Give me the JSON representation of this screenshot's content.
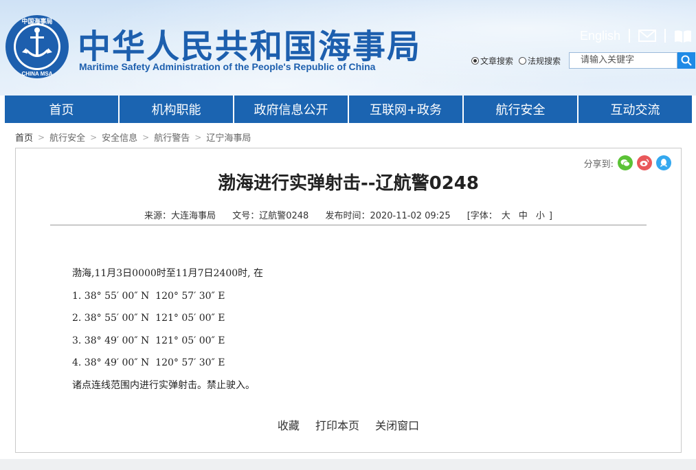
{
  "header": {
    "logo_text_cn": "中国海事局",
    "logo_text_en": "CHINA MSA",
    "title_cn": "中华人民共和国海事局",
    "title_en": "Maritime Safety Administration of the People's Republic of China",
    "english_link": "English",
    "mail_icon": "mail-icon",
    "book_icon": "book-icon"
  },
  "search": {
    "options": [
      {
        "label": "文章搜索",
        "selected": true
      },
      {
        "label": "法规搜索",
        "selected": false
      }
    ],
    "placeholder": "请输入关键字",
    "button_icon": "search-icon"
  },
  "nav": {
    "items": [
      "首页",
      "机构职能",
      "政府信息公开",
      "互联网+政务",
      "航行安全",
      "互动交流"
    ]
  },
  "breadcrumb": [
    "首页",
    "航行安全",
    "安全信息",
    "航行警告",
    "辽宁海事局"
  ],
  "share": {
    "label": "分享到:",
    "icons": [
      "wechat-icon",
      "weibo-icon",
      "qq-icon"
    ]
  },
  "article": {
    "title": "渤海进行实弹射击--辽航警0248",
    "source": "来源：大连海事局",
    "doc_no": "文号：辽航警0248",
    "publish_time": "发布时间：2020-11-02 09:25",
    "font_size_label": "[字体：",
    "font_sizes": [
      "大",
      "中",
      "小"
    ],
    "font_size_close": "]",
    "lines": [
      "渤海,11月3日0000时至11月7日2400时, 在",
      "1. 38° 55′ 00″ N  120° 57′ 30″ E",
      "2. 38° 55′ 00″ N  121° 05′ 00″ E",
      "3. 38° 49′ 00″ N  121° 05′ 00″ E",
      "4. 38° 49′ 00″ N  120° 57′ 30″ E",
      "诸点连线范围内进行实弹射击。禁止驶入。"
    ],
    "actions": [
      "收藏",
      "打印本页",
      "关闭窗口"
    ]
  },
  "colors": {
    "brand_blue": "#1d5fae",
    "nav_blue": "#1b64b1",
    "wechat_green": "#5bc236",
    "weibo_red": "#e9585a",
    "qq_blue": "#34a8ef"
  }
}
